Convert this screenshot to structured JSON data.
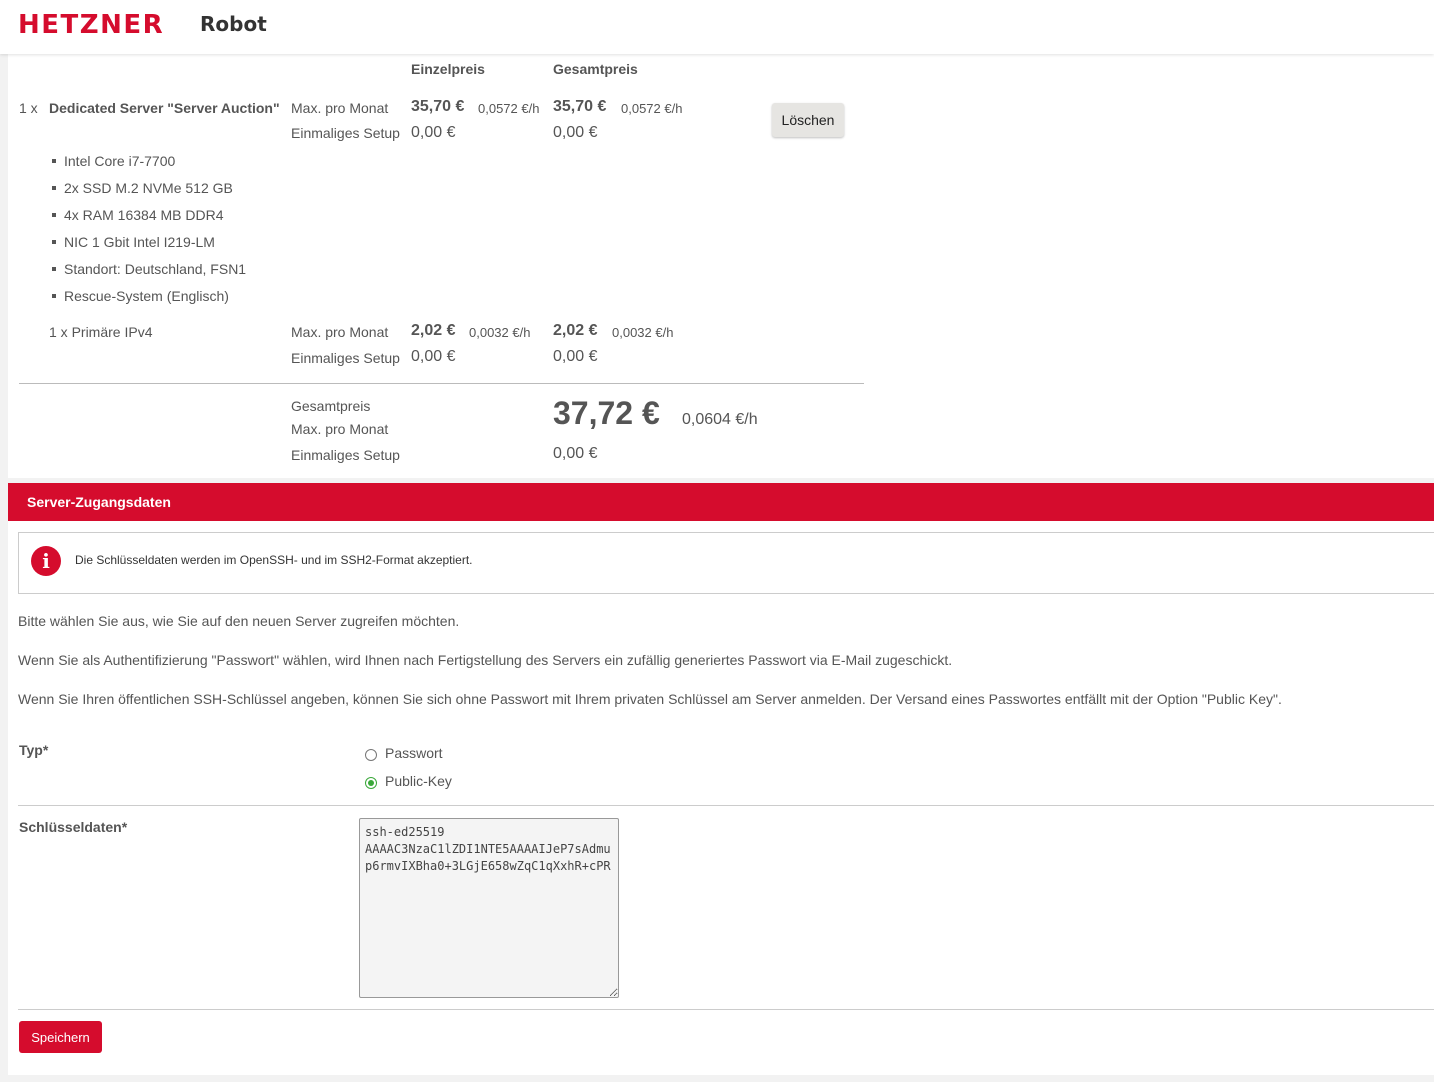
{
  "header": {
    "logo": "HETZNER",
    "product": "Robot"
  },
  "order": {
    "columns": {
      "unit": "Einzelpreis",
      "total": "Gesamtpreis"
    },
    "server": {
      "qty": "1 x",
      "name": "Dedicated Server \"Server Auction\"",
      "monthly_label": "Max. pro Monat",
      "setup_label": "Einmaliges Setup",
      "unit_monthly": "35,70 €",
      "unit_hourly": "0,0572 €/h",
      "total_monthly": "35,70 €",
      "total_hourly": "0,0572 €/h",
      "unit_setup": "0,00 €",
      "total_setup": "0,00 €",
      "delete_label": "Löschen",
      "specs": [
        "Intel Core i7-7700",
        "2x SSD M.2 NVMe 512 GB",
        "4x RAM 16384 MB DDR4",
        "NIC 1 Gbit Intel I219-LM",
        "Standort: Deutschland, FSN1",
        "Rescue-System (Englisch)"
      ]
    },
    "ipv4": {
      "name": "1 x Primäre IPv4",
      "monthly_label": "Max. pro Monat",
      "setup_label": "Einmaliges Setup",
      "unit_monthly": "2,02 €",
      "unit_hourly": "0,0032 €/h",
      "total_monthly": "2,02 €",
      "total_hourly": "0,0032 €/h",
      "unit_setup": "0,00 €",
      "total_setup": "0,00 €"
    },
    "summary": {
      "label": "Gesamtpreis",
      "monthly_label": "Max. pro Monat",
      "setup_label": "Einmaliges Setup",
      "monthly": "37,72 €",
      "hourly": "0,0604 €/h",
      "setup": "0,00 €"
    }
  },
  "access": {
    "title": "Server-Zugangsdaten",
    "info": "Die Schlüsseldaten werden im OpenSSH- und im SSH2-Format akzeptiert.",
    "paragraphs": [
      "Bitte wählen Sie aus, wie Sie auf den neuen Server zugreifen möchten.",
      "Wenn Sie als Authentifizierung \"Passwort\" wählen, wird Ihnen nach Fertigstellung des Servers ein zufällig generiertes Passwort via E-Mail zugeschickt.",
      "Wenn Sie Ihren öffentlichen SSH-Schlüssel angeben, können Sie sich ohne Passwort mit Ihrem privaten Schlüssel am Server anmelden. Der Versand eines Passwortes entfällt mit der Option \"Public Key\"."
    ],
    "type_label": "Typ*",
    "options": [
      "Passwort",
      "Public-Key"
    ],
    "selected_option": "Public-Key",
    "key_label": "Schlüsseldaten*",
    "key_value": "ssh-ed25519 AAAAC3NzaC1lZDI1NTE5AAAAIJeP7sAdmup6rmvIXBha0+3LGjE658wZqC1qXxhR+cPR",
    "save_label": "Speichern"
  },
  "colors": {
    "brand_red": "#d50c2d",
    "radio_green": "#3aa83a"
  }
}
